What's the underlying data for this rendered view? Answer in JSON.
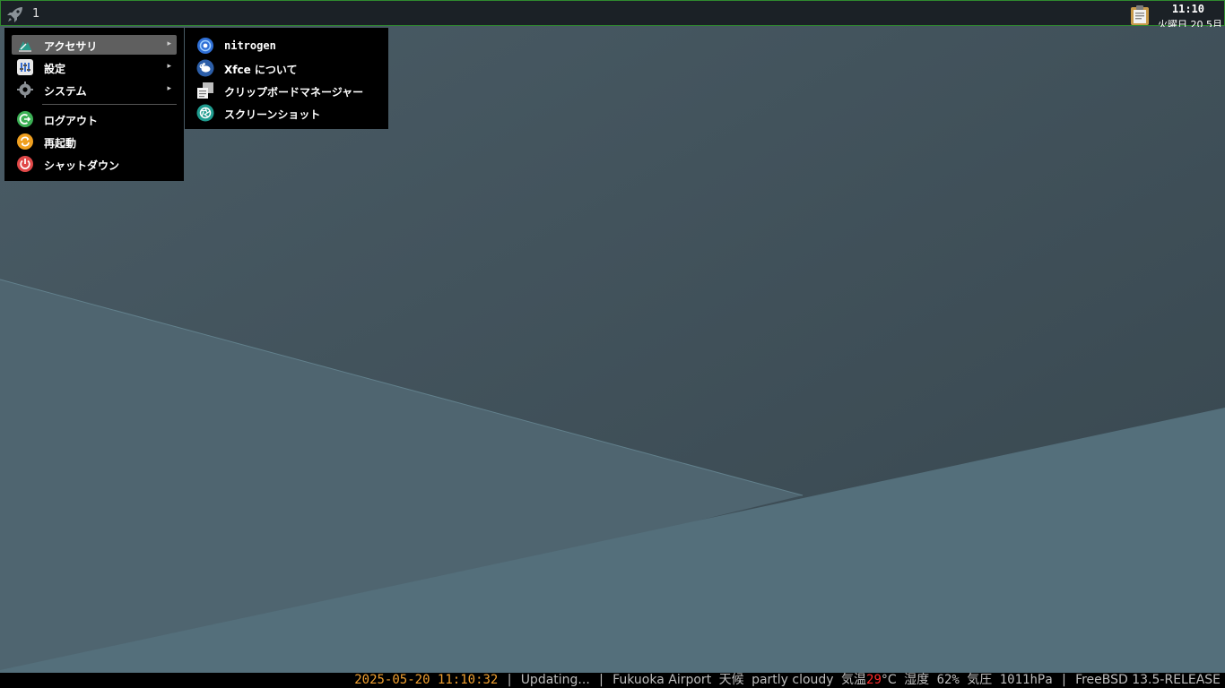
{
  "top_panel": {
    "workspace": "1",
    "clock_time": "11:10",
    "clock_date": "火曜日 20 5月",
    "icons": {
      "launcher": "rocket-icon",
      "clipboard": "clipboard-icon"
    },
    "border_color": "#2f8a2f"
  },
  "main_menu": {
    "items": [
      {
        "label": "アクセサリ",
        "icon": "accessories-icon",
        "has_submenu": true,
        "selected": true
      },
      {
        "label": "設定",
        "icon": "settings-icon",
        "has_submenu": true
      },
      {
        "label": "システム",
        "icon": "system-gear-icon",
        "has_submenu": true
      },
      {
        "label": "ログアウト",
        "icon": "logout-icon"
      },
      {
        "label": "再起動",
        "icon": "restart-icon"
      },
      {
        "label": "シャットダウン",
        "icon": "shutdown-icon"
      }
    ],
    "arrow": "▸"
  },
  "sub_menu": {
    "items": [
      {
        "label": "nitrogen",
        "icon": "nitrogen-icon"
      },
      {
        "label": "Xfce について",
        "icon": "xfce-mouse-icon"
      },
      {
        "label": "クリップボードマネージャー",
        "icon": "clipboard-manager-icon"
      },
      {
        "label": "スクリーンショット",
        "icon": "screenshot-icon"
      }
    ]
  },
  "status_bar": {
    "datetime": "2025-05-20 11:10:32",
    "sep": "|",
    "updating": "Updating...",
    "location": "Fukuoka Airport",
    "weather_label": "天候",
    "weather": "partly cloudy",
    "temp_label": "気温",
    "temp_value": "29",
    "temp_unit": "°C",
    "humidity_label": "湿度",
    "humidity": "62%",
    "pressure_label": "気圧",
    "pressure": "1011hPa",
    "os": "FreeBSD 13.5-RELEASE",
    "colors": {
      "datetime": "#f0a030",
      "hot_temp": "#ff2a2a"
    }
  }
}
